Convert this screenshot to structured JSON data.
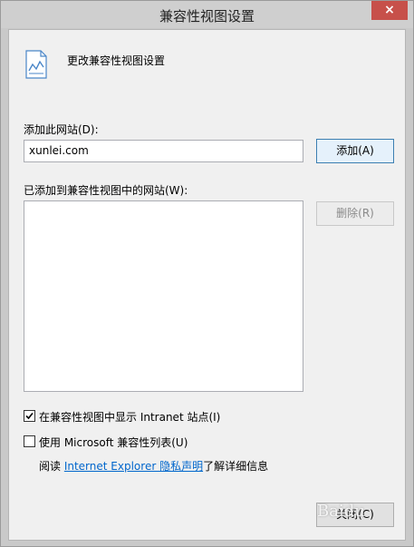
{
  "window": {
    "title": "兼容性视图设置",
    "close_glyph": "×"
  },
  "header": {
    "text": "更改兼容性视图设置",
    "icon": "document-chart-icon"
  },
  "add_site": {
    "label": "添加此网站(D):",
    "value": "xunlei.com",
    "button_label": "添加(A)"
  },
  "site_list": {
    "label": "已添加到兼容性视图中的网站(W):",
    "items": [],
    "remove_label": "删除(R)"
  },
  "options": {
    "intranet_label": "在兼容性视图中显示 Intranet 站点(I)",
    "intranet_checked": true,
    "microsoft_list_label": "使用 Microsoft 兼容性列表(U)",
    "microsoft_list_checked": false
  },
  "privacy": {
    "prefix": "阅读 ",
    "link_text": "Internet Explorer 隐私声明",
    "suffix": "了解详细信息"
  },
  "footer": {
    "close_label": "关闭(C)"
  },
  "watermark": "Baidu"
}
